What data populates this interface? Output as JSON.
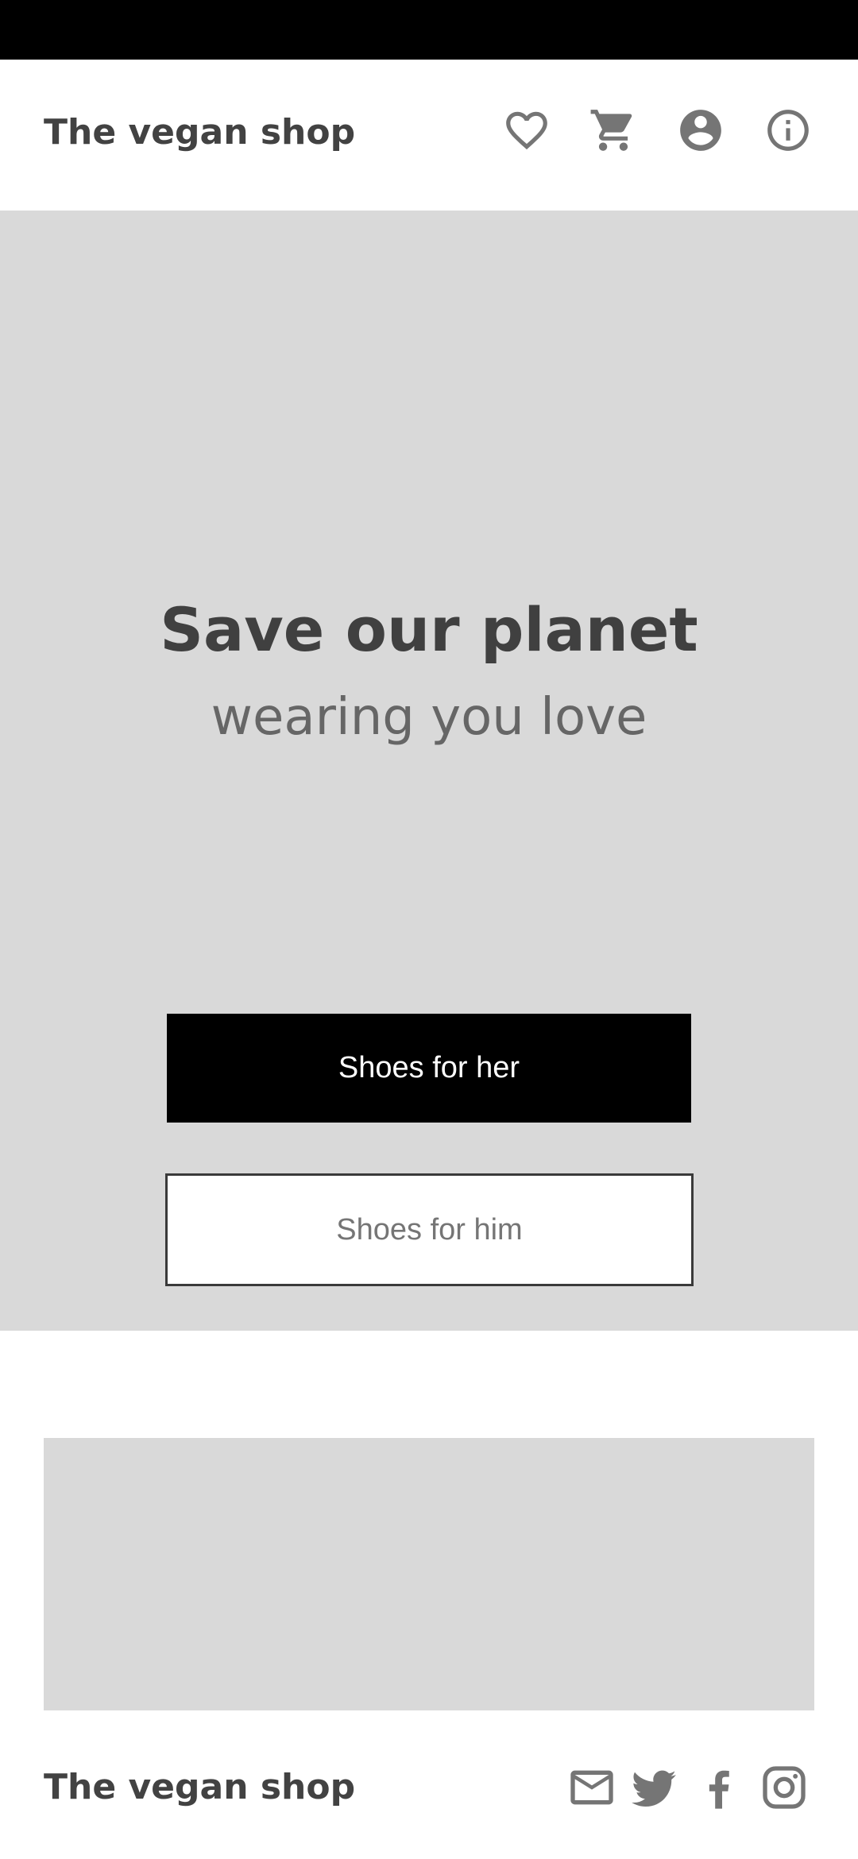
{
  "header": {
    "brand": "The vegan shop",
    "icons": [
      "heart-icon",
      "cart-icon",
      "account-icon",
      "info-icon"
    ]
  },
  "hero": {
    "title": "Save our planet",
    "subtitle": "wearing you love",
    "primary_button": "Shoes for her",
    "secondary_button": "Shoes for him"
  },
  "footer": {
    "brand": "The vegan shop",
    "social_icons": [
      "mail-icon",
      "twitter-icon",
      "facebook-icon",
      "instagram-icon"
    ]
  },
  "colors": {
    "status_bar": "#000000",
    "hero_background": "#d9d9d9",
    "text_dark": "#424242",
    "text_muted": "#666666",
    "icon_gray": "#757575",
    "primary_button_bg": "#000000",
    "primary_button_text": "#ffffff"
  }
}
